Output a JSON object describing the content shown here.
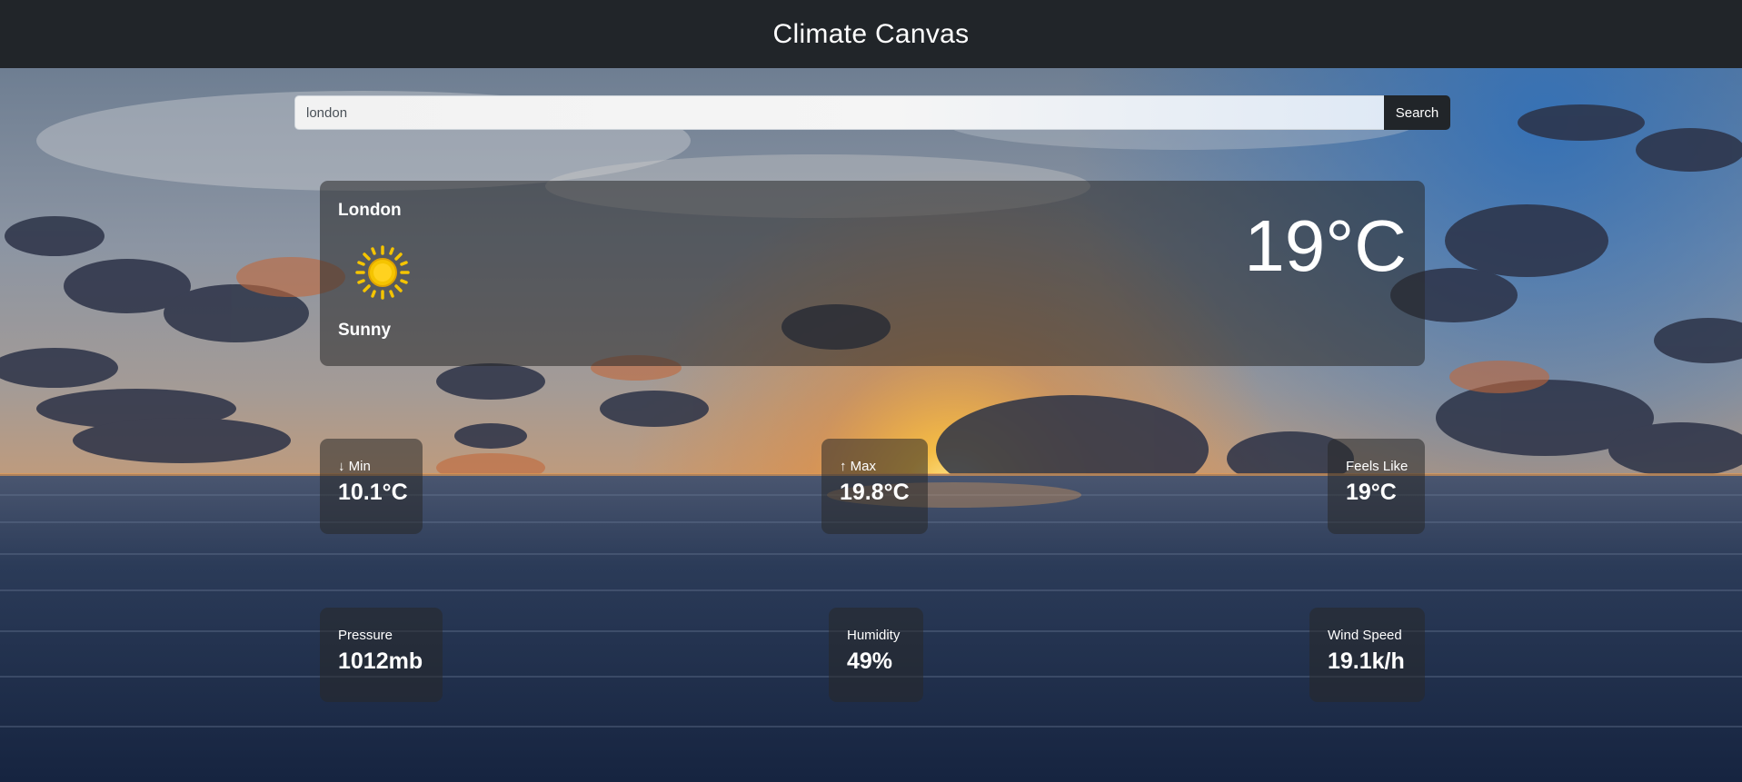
{
  "app": {
    "title": "Climate Canvas"
  },
  "search": {
    "value": "london",
    "button_label": "Search"
  },
  "current": {
    "city": "London",
    "temperature": "19°C",
    "condition": "Sunny",
    "icon": "sun-icon"
  },
  "stats": {
    "min": {
      "label": "↓ Min",
      "value": "10.1°C"
    },
    "max": {
      "label": "↑ Max",
      "value": "19.8°C"
    },
    "feels_like": {
      "label": "Feels Like",
      "value": "19°C"
    },
    "pressure": {
      "label": "Pressure",
      "value": "1012mb"
    },
    "humidity": {
      "label": "Humidity",
      "value": "49%"
    },
    "wind_speed": {
      "label": "Wind Speed",
      "value": "19.1k/h"
    }
  },
  "colors": {
    "navbar": "#212529",
    "card_overlay": "rgba(40,40,40,0.55)",
    "sun": "#f5c400",
    "button": "#212529"
  }
}
